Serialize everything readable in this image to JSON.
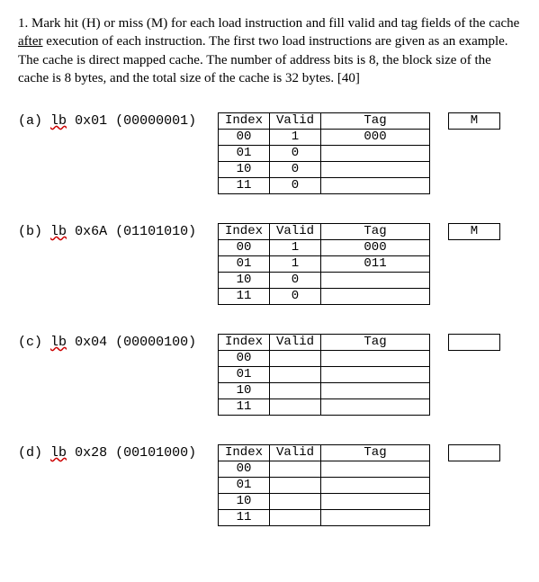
{
  "intro": {
    "num": "1.",
    "text_before_after": " Mark hit (H) or miss (M) for each load instruction and fill valid and tag fields of the cache ",
    "underlined": "after",
    "text_after_after": " execution of each instruction. The first two load instructions are given as an example. The cache is direct mapped cache. The number of address bits is 8, the block size of the cache is 8 bytes, and the total size of the cache is 32 bytes. [40]"
  },
  "headers": {
    "index": "Index",
    "valid": "Valid",
    "tag": "Tag"
  },
  "indices": [
    "00",
    "01",
    "10",
    "11"
  ],
  "problems": [
    {
      "id": "(a)",
      "instr_text": "lb 0x01 (00000001)",
      "hm": "M",
      "rows": [
        {
          "valid": "1",
          "tag": "000"
        },
        {
          "valid": "0",
          "tag": ""
        },
        {
          "valid": "0",
          "tag": ""
        },
        {
          "valid": "0",
          "tag": ""
        }
      ]
    },
    {
      "id": "(b)",
      "instr_text": "lb 0x6A (01101010)",
      "hm": "M",
      "rows": [
        {
          "valid": "1",
          "tag": "000"
        },
        {
          "valid": "1",
          "tag": "011"
        },
        {
          "valid": "0",
          "tag": ""
        },
        {
          "valid": "0",
          "tag": ""
        }
      ]
    },
    {
      "id": "(c)",
      "instr_text": "lb 0x04 (00000100)",
      "hm": "",
      "rows": [
        {
          "valid": "",
          "tag": ""
        },
        {
          "valid": "",
          "tag": ""
        },
        {
          "valid": "",
          "tag": ""
        },
        {
          "valid": "",
          "tag": ""
        }
      ]
    },
    {
      "id": "(d)",
      "instr_text": "lb 0x28 (00101000)",
      "hm": "",
      "rows": [
        {
          "valid": "",
          "tag": ""
        },
        {
          "valid": "",
          "tag": ""
        },
        {
          "valid": "",
          "tag": ""
        },
        {
          "valid": "",
          "tag": ""
        }
      ]
    }
  ]
}
